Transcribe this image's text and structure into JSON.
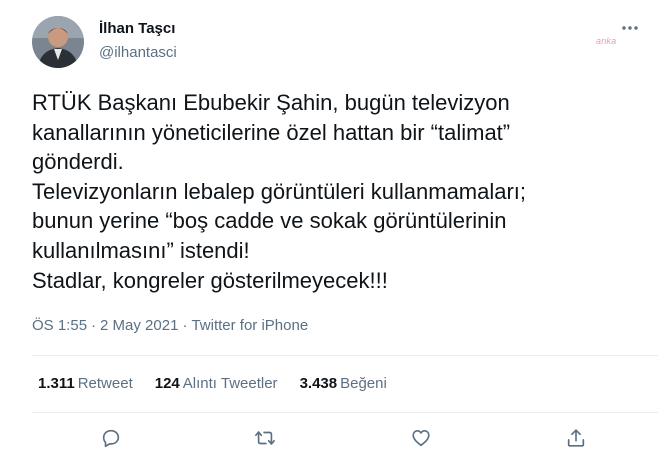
{
  "author": {
    "name": "İlhan Taşcı",
    "handle": "@ilhantasci"
  },
  "watermark": "anka",
  "tweet": {
    "lines": [
      "RTÜK Başkanı Ebubekir Şahin, bugün televizyon",
      "kanallarının yöneticilerine özel hattan bir “talimat”",
      "gönderdi.",
      "Televizyonların lebalep görüntüleri kullanmamaları;",
      "bunun yerine “boş cadde ve sokak görüntülerinin",
      "kullanılmasını” istendi!",
      "Stadlar, kongreler gösterilmeyecek!!!"
    ],
    "time": "ÖS 1:55",
    "date": "2 May 2021",
    "source": "Twitter for iPhone"
  },
  "stats": {
    "retweets": "1.311",
    "retweets_label": "Retweet",
    "quotes": "124",
    "quotes_label": "Alıntı Tweetler",
    "likes": "3.438",
    "likes_label": "Beğeni"
  },
  "icons": {
    "reply": "reply-icon",
    "retweet": "retweet-icon",
    "like": "heart-icon",
    "share": "share-icon",
    "more": "more-icon"
  },
  "colors": {
    "text": "#0f1419",
    "secondary": "#5b7083",
    "divider": "#e6ecf0"
  }
}
